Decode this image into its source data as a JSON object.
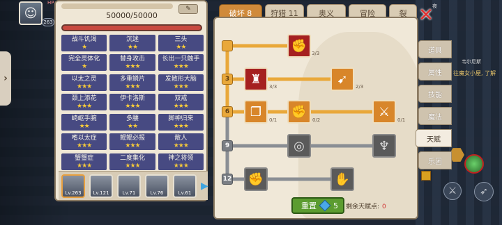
{
  "hud": {
    "hp_label": "HP",
    "hero_level": "263",
    "top_right_text": "夜"
  },
  "exp": {
    "text": "50000/50000",
    "edit_icon": "pencil-icon"
  },
  "buffs": [
    {
      "name": "战斗饥渴",
      "stars": "★"
    },
    {
      "name": "沉迷",
      "stars": "★★"
    },
    {
      "name": "三头",
      "stars": "★★"
    },
    {
      "name": "完全灵体化",
      "stars": "★"
    },
    {
      "name": "替身攻击",
      "stars": "★★★"
    },
    {
      "name": "长出一只触手",
      "stars": "★★★"
    },
    {
      "name": "以太之灵",
      "stars": "★★★"
    },
    {
      "name": "多重鳞片",
      "stars": "★★★"
    },
    {
      "name": "发散形大脑",
      "stars": "★★★"
    },
    {
      "name": "颈上添花",
      "stars": "★★★"
    },
    {
      "name": "伊卡洛斯",
      "stars": "★★★"
    },
    {
      "name": "双戒",
      "stars": "★★★"
    },
    {
      "name": "崎岖手腕",
      "stars": "★★"
    },
    {
      "name": "多腰",
      "stars": "★★"
    },
    {
      "name": "脚神归来",
      "stars": "★★★"
    },
    {
      "name": "嗜以太症",
      "stars": "★★★"
    },
    {
      "name": "鲲鲲必报",
      "stars": "★★★"
    },
    {
      "name": "散人",
      "stars": "★★★"
    },
    {
      "name": "蟹蟹症",
      "stars": "★★★"
    },
    {
      "name": "二度集化",
      "stars": "★★★"
    },
    {
      "name": "神之将领",
      "stars": "★★★"
    }
  ],
  "team": [
    {
      "level": "Lv.263"
    },
    {
      "level": "Lv.121"
    },
    {
      "level": "Lv.71"
    },
    {
      "level": "Lv.76"
    },
    {
      "level": "Lv.61"
    }
  ],
  "tabs": [
    {
      "label": "破坏 8",
      "active": true
    },
    {
      "label": "狩猎 11",
      "active": false
    },
    {
      "label": "奥义",
      "active": false
    },
    {
      "label": "冒险",
      "active": false
    },
    {
      "label": "裂",
      "active": false
    }
  ],
  "tree": {
    "levels": [
      "3",
      "6",
      "9",
      "12"
    ],
    "nodes": [
      {
        "icon": "handshake-icon",
        "count": "3/3",
        "state": "red"
      },
      {
        "icon": "muscle-body-icon",
        "count": "3/3",
        "state": "red"
      },
      {
        "icon": "arrow-icon",
        "count": "2/3",
        "state": "orange"
      },
      {
        "icon": "scroll-icon",
        "count": "0/1",
        "state": "orange"
      },
      {
        "icon": "fist-icon",
        "count": "0/2",
        "state": "orange"
      },
      {
        "icon": "sword-slash-icon",
        "count": "0/1",
        "state": "orange"
      },
      {
        "icon": "ring-icon",
        "count": "",
        "state": "grey"
      },
      {
        "icon": "claw-icon",
        "count": "",
        "state": "grey"
      },
      {
        "icon": "raised-fist-icon",
        "count": "",
        "state": "grey"
      },
      {
        "icon": "grab-hand-icon",
        "count": "",
        "state": "grey"
      }
    ],
    "reset_label": "重置",
    "reset_cost": "5",
    "remaining_label": "剩余天赋点:",
    "remaining_value": "0"
  },
  "categories": [
    {
      "label": "道具",
      "active": false
    },
    {
      "label": "属性",
      "active": false
    },
    {
      "label": "技能",
      "active": false
    },
    {
      "label": "魔法",
      "active": false
    },
    {
      "label": "天赋",
      "active": true
    },
    {
      "label": "乐团",
      "active": false
    }
  ],
  "world": {
    "chat": "往魔女小屋, 了解",
    "npc_name": "韦尔尼斯"
  },
  "colors": {
    "active_tab": "#d08a3a",
    "buff_cell": "#474a82",
    "star": "#f5c93a",
    "node_red": "#a52020",
    "node_orange": "#d8862a"
  }
}
